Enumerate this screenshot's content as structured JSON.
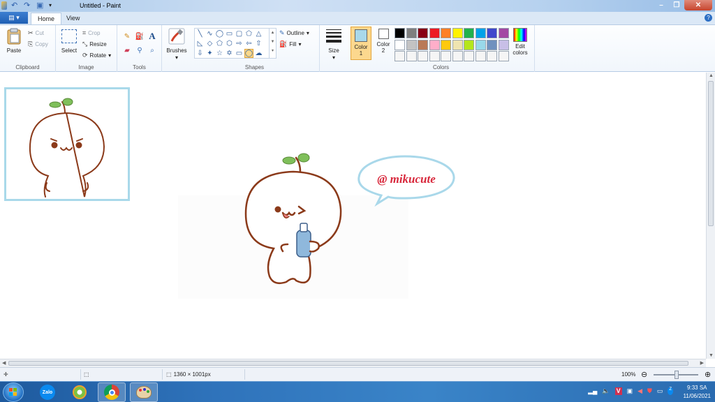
{
  "window": {
    "title": "Untitled - Paint"
  },
  "tabs": {
    "file": "▤ ▾",
    "home": "Home",
    "view": "View"
  },
  "clipboard": {
    "paste": "Paste",
    "cut": "Cut",
    "copy": "Copy",
    "group": "Clipboard"
  },
  "image": {
    "select": "Select",
    "crop": "Crop",
    "resize": "Resize",
    "rotate": "Rotate",
    "group": "Image"
  },
  "tools": {
    "group": "Tools",
    "text_icon": "A"
  },
  "brushes": {
    "label": "Brushes"
  },
  "shapes": {
    "outline": "Outline",
    "fill": "Fill",
    "group": "Shapes"
  },
  "size": {
    "label": "Size"
  },
  "colors": {
    "color1_label": "Color",
    "color1_num": "1",
    "color2_label": "Color",
    "color2_num": "2",
    "edit_label": "Edit",
    "edit_label2": "colors",
    "group": "Colors",
    "color1": "#a9d8ea",
    "color2": "#ffffff",
    "palette": [
      "#000000",
      "#7f7f7f",
      "#880015",
      "#ed1c24",
      "#ff7f27",
      "#fff200",
      "#22b14c",
      "#00a2e8",
      "#3f48cc",
      "#a349a4",
      "#ffffff",
      "#c3c3c3",
      "#b97a57",
      "#ffaec9",
      "#ffc90e",
      "#efe4b0",
      "#b5e61d",
      "#99d9ea",
      "#7092be",
      "#c8bfe7",
      "#f5f5f5",
      "#f5f5f5",
      "#f5f5f5",
      "#f5f5f5",
      "#f5f5f5",
      "#f5f5f5",
      "#f5f5f5",
      "#f5f5f5",
      "#f5f5f5",
      "#f5f5f5"
    ]
  },
  "canvas": {
    "watermark": "@ mikucute"
  },
  "status": {
    "dimensions": "1360 × 1001px",
    "zoom": "100%"
  },
  "taskbar": {
    "zalo": "Zalo",
    "time": "9:33 SA",
    "date": "11/06/2021"
  }
}
